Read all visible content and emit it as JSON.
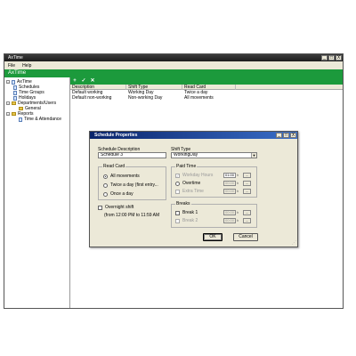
{
  "app": {
    "title": "AxTime",
    "header": "AxTime",
    "menu": [
      "File",
      "Help"
    ],
    "controls": {
      "minimize": "_",
      "maximize": "□",
      "close": "X"
    }
  },
  "toolbar": {
    "add": "+",
    "edit": "✓",
    "delete": "✕"
  },
  "tree": {
    "root": "AxTime",
    "items": [
      "Schedules",
      "Time Groups",
      "Holidays",
      "Departments/Users",
      "General",
      "Reports",
      "Time & Attendance"
    ]
  },
  "list": {
    "headers": [
      "Description",
      "Shift Type",
      "Read Card"
    ],
    "rows": [
      [
        "Default working",
        "Working Day",
        "Twice a day"
      ],
      [
        "Default non-working",
        "Non-working Day",
        "All movements"
      ]
    ]
  },
  "dialog": {
    "title": "Schedule Properties",
    "controls": {
      "minimize": "_",
      "maximize": "□",
      "close": "X"
    },
    "schedule_description_label": "Schedule Description",
    "schedule_description_value": "Schedule 3",
    "shift_type_label": "Shift Type",
    "shift_type_value": "WorkingDay",
    "read_card": {
      "title": "Read Card",
      "options": [
        "All movements",
        "Twice a day (first entry...",
        "Once a day"
      ]
    },
    "overnight_shift": {
      "label": "Overnight shift",
      "range": "(from 12:00 PM to 11:59 AM"
    },
    "paid_time": {
      "title": "Paid Time",
      "rows": [
        {
          "label": "Workday Hours",
          "value": "01:00"
        },
        {
          "label": "Overtime",
          "value": "00:00"
        },
        {
          "label": "Extra Time",
          "value": "00:00"
        }
      ],
      "unit": "h"
    },
    "breaks": {
      "title": "Breaks",
      "rows": [
        {
          "label": "Break 1",
          "value": "00:00"
        },
        {
          "label": "Break 2",
          "value": "00:00"
        }
      ],
      "unit": "h"
    },
    "ellipsis": "...",
    "ok": "OK",
    "cancel": "Cancel"
  }
}
